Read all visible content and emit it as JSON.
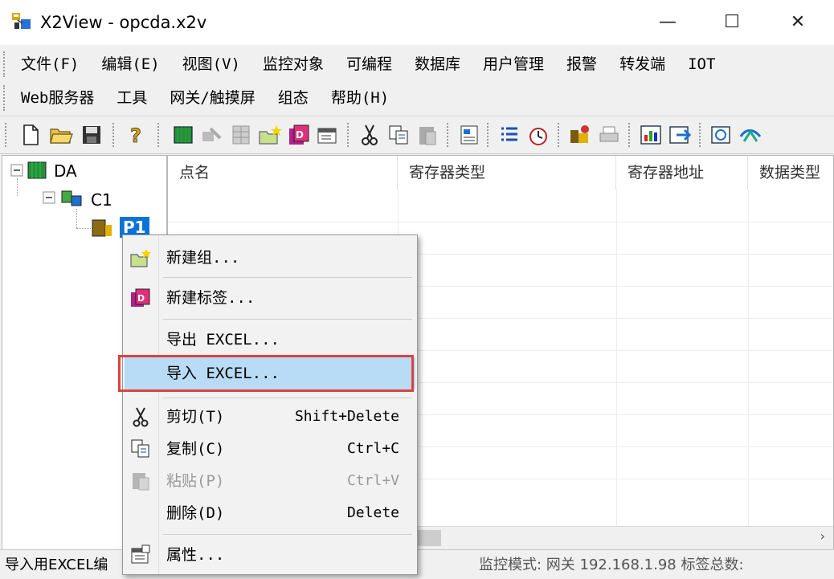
{
  "window": {
    "title": "X2View - opcda.x2v",
    "minimize": "—",
    "maximize": "☐",
    "close": "✕"
  },
  "menubar": {
    "row1": [
      "文件(F)",
      "编辑(E)",
      "视图(V)",
      "监控对象",
      "可编程",
      "数据库",
      "用户管理",
      "报警",
      "转发端",
      "IOT"
    ],
    "row2": [
      "Web服务器",
      "工具",
      "网关/触摸屏",
      "组态",
      "帮助(H)"
    ]
  },
  "tree": {
    "root": "DA",
    "child": "C1",
    "leaf": "P1"
  },
  "columns": [
    "点名",
    "寄存器类型",
    "寄存器地址",
    "数据类型"
  ],
  "context_menu": {
    "new_group": "新建组...",
    "new_tag": "新建标签...",
    "export_excel": "导出 EXCEL...",
    "import_excel": "导入 EXCEL...",
    "cut": "剪切(T)",
    "cut_sc": "Shift+Delete",
    "copy": "复制(C)",
    "copy_sc": "Ctrl+C",
    "paste": "粘贴(P)",
    "paste_sc": "Ctrl+V",
    "delete": "删除(D)",
    "delete_sc": "Delete",
    "properties": "属性..."
  },
  "status": {
    "left": "导入用EXCEL编",
    "right": "监控模式: 网关 192.168.1.98 标签总数:"
  },
  "colors": {
    "highlight": "#b8dcf5",
    "annotation_border": "#e04040",
    "tree_selected": "#0b73d8"
  }
}
